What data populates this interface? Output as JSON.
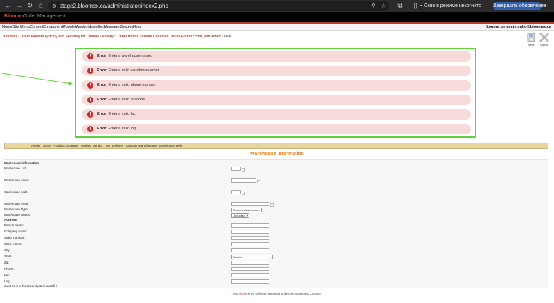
{
  "browser": {
    "url": "stage2.bloomex.ca/administrator/index2.php",
    "incognito_label": "Окно в режиме инкогнито",
    "update_button": "Завершить обновление",
    "icons": [
      "back-icon",
      "forward-icon",
      "reload-icon",
      "home-icon",
      "site-info-icon",
      "zoom-icon",
      "bookmark-star-icon",
      "extensions-icon",
      "sidebar-icon",
      "incognito-icon",
      "menu-dots-icon"
    ]
  },
  "header": {
    "logo": "Bloomex",
    "logo_sub": "Order Management"
  },
  "menu": {
    "items": [
      "Home",
      "Site",
      "Menu",
      "Content",
      "Components",
      "Modules",
      "Mambots",
      "Installers",
      "Messages",
      "System",
      "Help"
    ],
    "logout": "Logout: artem.tetsulig@bloomex.ca"
  },
  "breadcrumb": {
    "text": "Bloomex - Order Flowers Quickly and Securely for Canada Delivery :: Order from a Trusted Canadian Online Florist / com_virtuemart / ",
    "current": "save"
  },
  "toolbar": {
    "save_label": "Save",
    "cancel_label": "Cancel"
  },
  "errors": [
    {
      "prefix": "Error",
      "message": ": Enter a warehouse name."
    },
    {
      "prefix": "Error",
      "message": ": Enter a valid warehouse email."
    },
    {
      "prefix": "Error",
      "message": ": Enter a valid phone number."
    },
    {
      "prefix": "Error",
      "message": ": Enter a valid zip code."
    },
    {
      "prefix": "Error",
      "message": ": Enter a valid lat."
    },
    {
      "prefix": "Error",
      "message": ": Enter a valid lng."
    }
  ],
  "admin_menu": {
    "items": [
      "Admin",
      "Store",
      "Products",
      "Shopper",
      "Orders",
      "Vendor",
      "Tax",
      "Delivery",
      "Coupon",
      "Manufacturer",
      "Warehouse",
      "Help"
    ]
  },
  "form": {
    "title": "Warehouse Information",
    "section": "Warehouse information",
    "labels": {
      "list": "Warehouse List:",
      "name": "Warehouse name:",
      "code": "Warehouse code:",
      "email": "Warehouse email:",
      "type": "Warehouse Type:",
      "status": "Warehouse Status:",
      "address": "Address:",
      "person": "Person name:",
      "company": "Company name:",
      "street_number": "Street number:",
      "street_name": "Street name:",
      "city": "City:",
      "state": "State:",
      "zip": "Zip:",
      "phone": "Phone:",
      "lat": "Lat:",
      "lng": "Lng:",
      "note": "must be 0 to for driver system autofill it"
    },
    "type_value": "Bloomex Warehouse",
    "status_value": "Unpublish",
    "state_value": "Alberta"
  },
  "footer": {
    "joomla": "Joomla!",
    "text": " is Free Software released under the GNU/GPL License."
  }
}
